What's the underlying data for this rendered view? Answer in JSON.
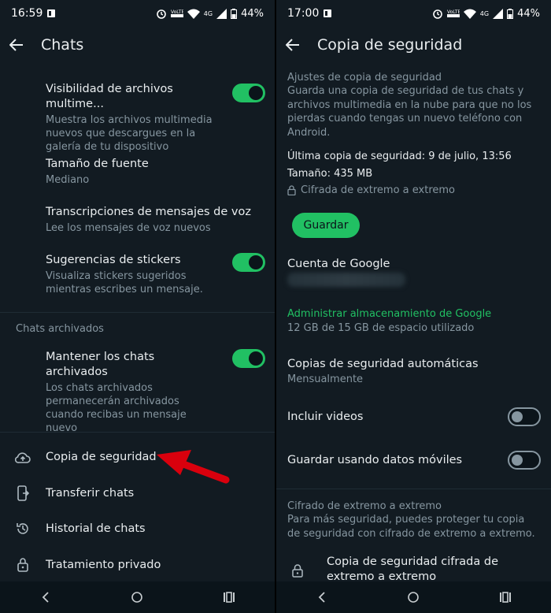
{
  "left": {
    "status": {
      "time": "16:59",
      "battery": "44%",
      "network": "4G"
    },
    "appbar": {
      "title": "Chats"
    },
    "items": [
      {
        "title": "Visibilidad de archivos multime...",
        "subtitle": "Muestra los archivos multimedia nuevos que descargues en la galería de tu dispositivo",
        "toggle": true
      },
      {
        "title": "Tamaño de fuente",
        "subtitle": "Mediano"
      },
      {
        "title": "Transcripciones de mensajes de voz",
        "subtitle": "Lee los mensajes de voz nuevos"
      },
      {
        "title": "Sugerencias de stickers",
        "subtitle": "Visualiza stickers sugeridos mientras escribes un mensaje.",
        "toggle": true
      }
    ],
    "archived_section": "Chats archivados",
    "archived_item": {
      "title": "Mantener los chats archivados",
      "subtitle": "Los chats archivados permanecerán archivados cuando recibas un mensaje nuevo",
      "toggle": true
    },
    "nav_items": [
      "Copia de seguridad",
      "Transferir chats",
      "Historial de chats",
      "Tratamiento privado"
    ]
  },
  "right": {
    "status": {
      "time": "17:00",
      "battery": "44%",
      "network": "4G"
    },
    "appbar": {
      "title": "Copia de seguridad"
    },
    "settings_heading": "Ajustes de copia de seguridad",
    "settings_desc": "Guarda una copia de seguridad de tus chats y archivos multimedia en la nube para que no los pierdas cuando tengas un nuevo teléfono con Android.",
    "last_backup": "Última copia de seguridad: 9 de julio, 13:56",
    "size": "Tamaño: 435 MB",
    "encrypted": "Cifrada de extremo a extremo",
    "save_button": "Guardar",
    "google_account": "Cuenta de Google",
    "manage_storage": "Administrar almacenamiento de Google",
    "storage_used": "12 GB de 15 GB de espacio utilizado",
    "auto_backup_title": "Copias de seguridad automáticas",
    "auto_backup_value": "Mensualmente",
    "include_videos": "Incluir videos",
    "mobile_data": "Guardar usando datos móviles",
    "e2e_heading": "Cifrado de extremo a extremo",
    "e2e_desc": "Para más seguridad, puedes proteger tu copia de seguridad con cifrado de extremo a extremo.",
    "e2e_item": "Copia de seguridad cifrada de extremo a extremo"
  },
  "colors": {
    "accent": "#21c063",
    "background": "#121b22",
    "arrow": "#d9000d"
  }
}
